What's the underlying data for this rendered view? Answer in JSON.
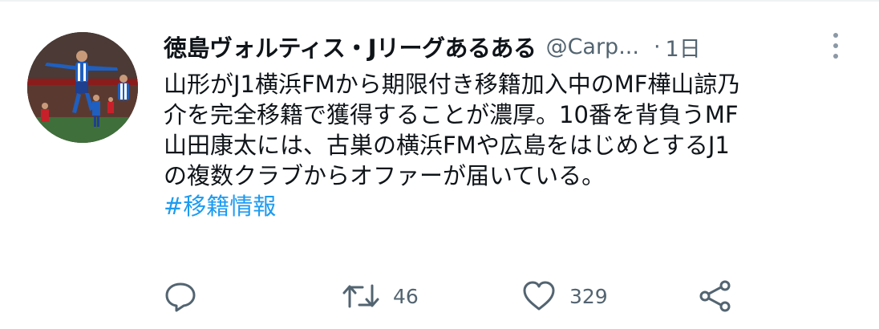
{
  "tweet": {
    "display_name": "徳島ヴォルティス・Jリーグあるある",
    "handle": "@Carp...",
    "separator": "·",
    "timestamp": "1日",
    "text_lines": [
      "山形がJ1横浜FMから期限付き移籍加入中のMF樺山諒乃",
      "介を完全移籍で獲得することが濃厚。10番を背負うMF",
      "山田康太には、古巣の横浜FMや広島をはじめとするJ1",
      "の複数クラブからオファーが届いている。"
    ],
    "hashtag": "#移籍情報"
  },
  "actions": {
    "reply": {
      "icon": "reply-icon",
      "count": ""
    },
    "retweet": {
      "icon": "retweet-icon",
      "count": "46"
    },
    "like": {
      "icon": "heart-icon",
      "count": "329"
    },
    "share": {
      "icon": "share-icon"
    }
  },
  "colors": {
    "text": "#0f1419",
    "secondary": "#536471",
    "link": "#1d9bf0",
    "background": "#ffffff"
  }
}
